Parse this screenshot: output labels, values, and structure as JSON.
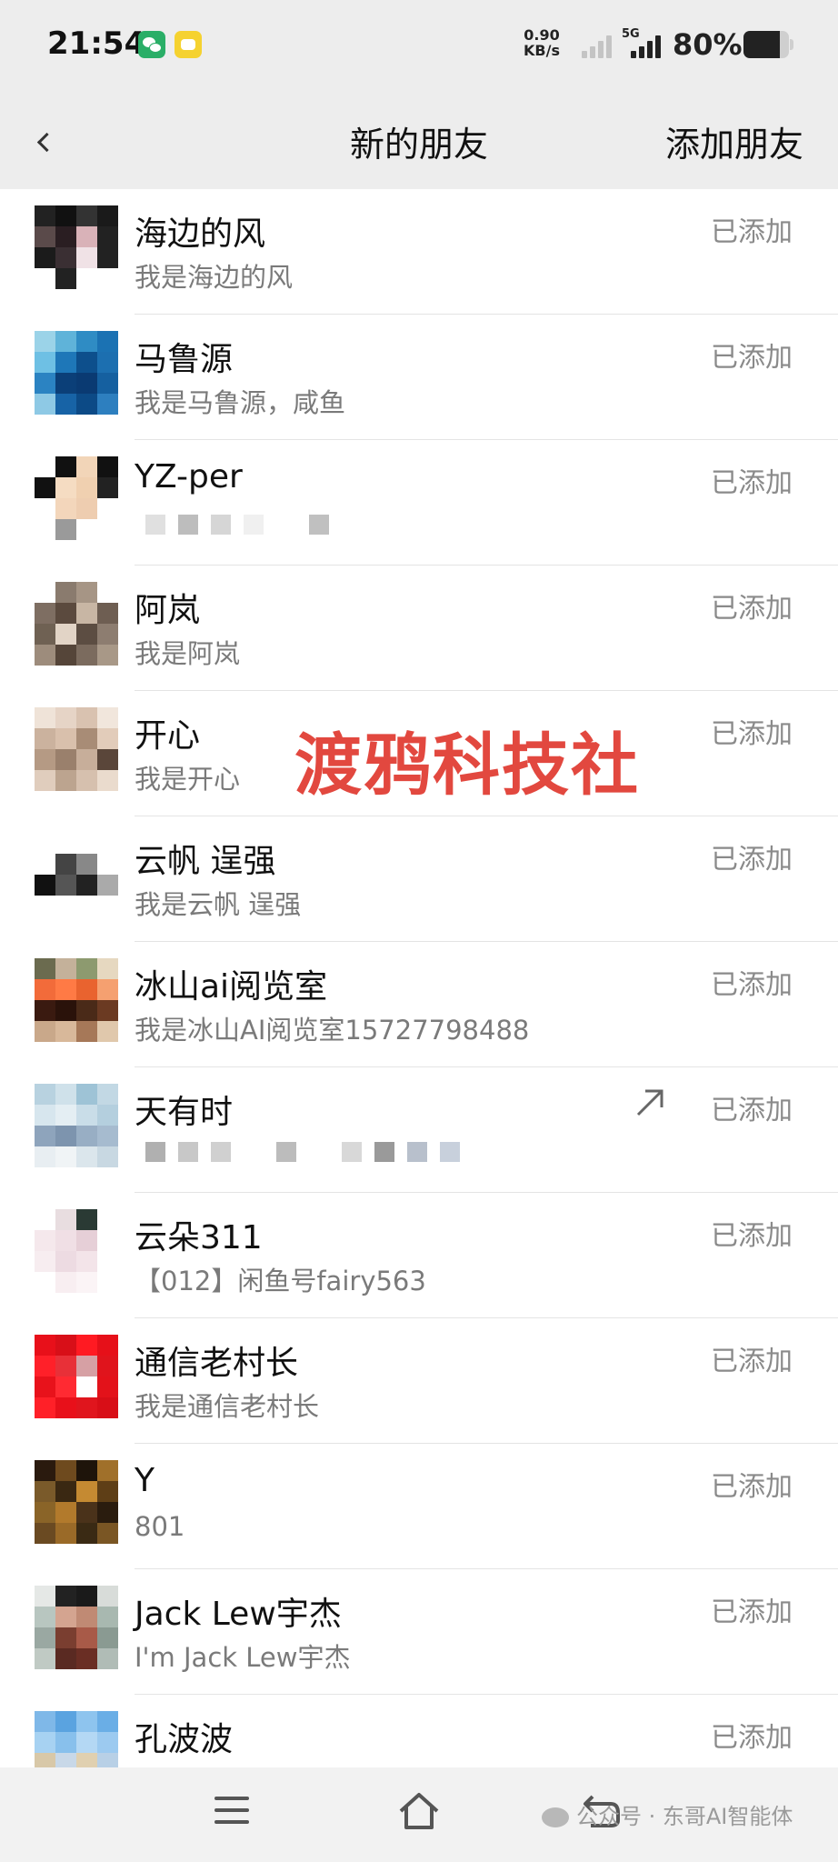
{
  "status_bar": {
    "time": "21:54",
    "net_speed_value": "0.90",
    "net_speed_unit": "KB/s",
    "network_label": "5G",
    "battery_percent": "80%",
    "battery_level": 0.8
  },
  "nav": {
    "title": "新的朋友",
    "action": "添加朋友"
  },
  "friends": [
    {
      "name": "海边的风",
      "note": "我是海边的风",
      "status": "已添加"
    },
    {
      "name": "马鲁源",
      "note": "我是马鲁源，咸鱼",
      "status": "已添加"
    },
    {
      "name": "YZ-per",
      "note": "",
      "status": "已添加"
    },
    {
      "name": "阿岚",
      "note": "我是阿岚",
      "status": "已添加"
    },
    {
      "name": "开心",
      "note": "我是开心",
      "status": "已添加"
    },
    {
      "name": "云帆 逞强",
      "note": "我是云帆 逞强",
      "status": "已添加"
    },
    {
      "name": "冰山ai阅览室",
      "note": "我是冰山AI阅览室15727798488",
      "status": "已添加"
    },
    {
      "name": "天有时",
      "note": "",
      "status": "已添加"
    },
    {
      "name": "云朵311",
      "note": "【012】闲鱼号fairy563",
      "status": "已添加"
    },
    {
      "name": "通信老村长",
      "note": "我是通信老村长",
      "status": "已添加"
    },
    {
      "name": "Y",
      "note": "801",
      "status": "已添加"
    },
    {
      "name": "Jack Lew宇杰",
      "note": "I'm Jack Lew宇杰",
      "status": "已添加"
    },
    {
      "name": "孔波波",
      "note": "",
      "status": "已添加"
    }
  ],
  "watermark": "渡鸦科技社",
  "bottom_credit": "公众号 · 东哥AI智能体",
  "icons": {
    "back": "back-arrow-icon",
    "share": "share-arrow-icon",
    "menu": "menu-icon",
    "home": "home-icon",
    "system_back": "system-back-icon"
  }
}
